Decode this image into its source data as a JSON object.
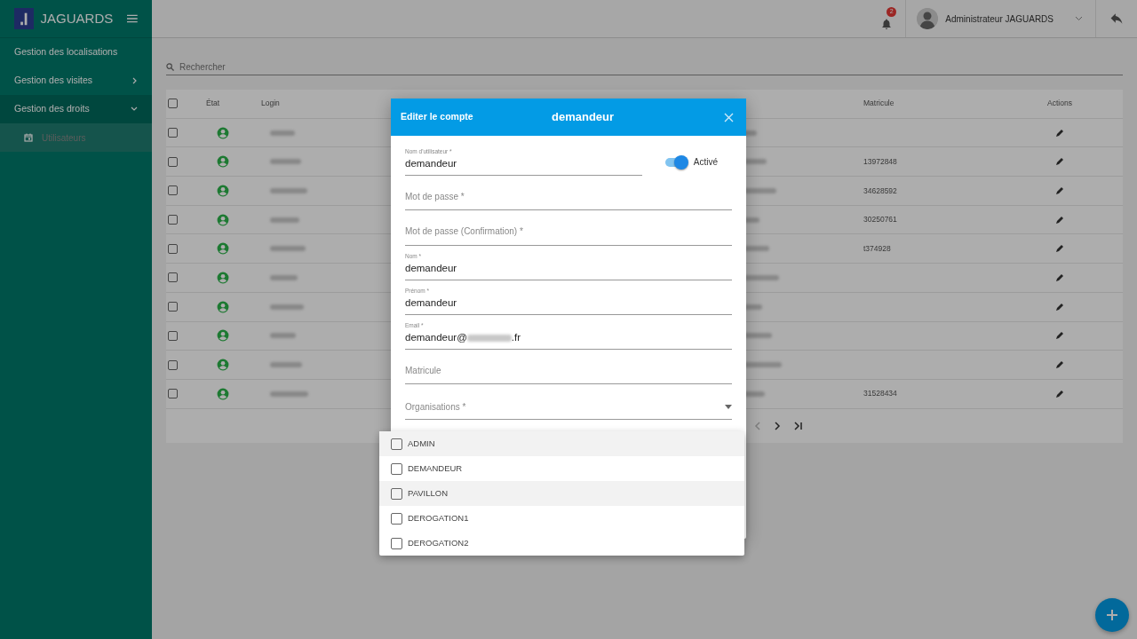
{
  "app": {
    "brand": "JAGUARDS"
  },
  "sidebar": {
    "items": [
      {
        "label": "Gestion des localisations",
        "kind": "link"
      },
      {
        "label": "Gestion des visites",
        "kind": "group",
        "expanded": false
      },
      {
        "label": "Gestion des droits",
        "kind": "group",
        "expanded": true,
        "children": [
          {
            "label": "Utilisateurs",
            "selected": true
          }
        ]
      }
    ]
  },
  "topbar": {
    "notification_count": "2",
    "user_name": "Administrateur JAGUARDS"
  },
  "search": {
    "placeholder": "Rechercher"
  },
  "table": {
    "select_all_checked": false,
    "columns": [
      "État",
      "Login",
      "Matricule",
      "Actions"
    ],
    "rows": [
      {
        "checked": false,
        "active": true,
        "matricule": ""
      },
      {
        "checked": false,
        "active": true,
        "matricule": "13972848"
      },
      {
        "checked": false,
        "active": true,
        "matricule": "34628592"
      },
      {
        "checked": false,
        "active": true,
        "matricule": "30250761"
      },
      {
        "checked": false,
        "active": true,
        "matricule": "t374928"
      },
      {
        "checked": false,
        "active": true,
        "matricule": ""
      },
      {
        "checked": false,
        "active": true,
        "matricule": ""
      },
      {
        "checked": false,
        "active": true,
        "matricule": ""
      },
      {
        "checked": false,
        "active": true,
        "matricule": ""
      },
      {
        "checked": false,
        "active": true,
        "matricule": "31528434"
      }
    ]
  },
  "pagination": {
    "previous_disabled": true
  },
  "dialog": {
    "title": "Editer le compte",
    "subtitle": "demandeur",
    "toggle": {
      "label": "Activé",
      "on": true
    },
    "fields": [
      {
        "kind": "text",
        "label": "Nom d'utilisateur *",
        "value": "demandeur"
      },
      {
        "kind": "text",
        "placeholder": "Mot de passe *"
      },
      {
        "kind": "text",
        "placeholder": "Mot de passe (Confirmation) *"
      },
      {
        "kind": "text",
        "label": "Nom *",
        "value": "demandeur"
      },
      {
        "kind": "text",
        "label": "Prénom *",
        "value": "demandeur"
      },
      {
        "kind": "email",
        "label": "Email *",
        "value": "demandeur@",
        "suffix": ".fr"
      },
      {
        "kind": "text",
        "placeholder": "Matricule"
      },
      {
        "kind": "select",
        "placeholder": "Organisations *"
      }
    ]
  },
  "dropdown": {
    "options": [
      {
        "label": "ADMIN",
        "checked": false,
        "highlighted": true
      },
      {
        "label": "DEMANDEUR",
        "checked": false,
        "highlighted": false
      },
      {
        "label": "PAVILLON",
        "checked": false,
        "highlighted": true
      },
      {
        "label": "DEROGATION1",
        "checked": false,
        "highlighted": false
      },
      {
        "label": "DEROGATION2",
        "checked": false,
        "highlighted": false
      }
    ]
  }
}
